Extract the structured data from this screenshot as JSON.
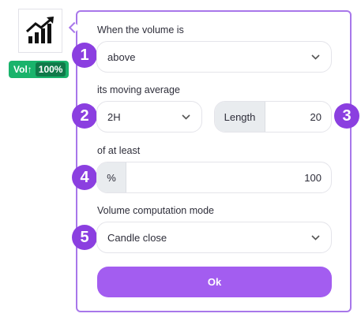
{
  "indicator": {
    "icon": "chart-trend-icon",
    "badge_label": "Vol↑",
    "badge_value": "100%"
  },
  "form": {
    "volume_label": "When the volume is",
    "volume_selected": "above",
    "average_label": "its moving average",
    "average_selected": "2H",
    "length_label": "Length",
    "length_value": "20",
    "least_label": "of at least",
    "percent_unit": "%",
    "percent_value": "100",
    "mode_label": "Volume computation mode",
    "mode_selected": "Candle close",
    "ok_label": "Ok"
  },
  "steps": [
    "1",
    "2",
    "3",
    "4",
    "5"
  ],
  "colors": {
    "accent": "#a877ea",
    "step": "#8b3fe0",
    "button": "#a35df0",
    "badge": "#19b36b"
  }
}
